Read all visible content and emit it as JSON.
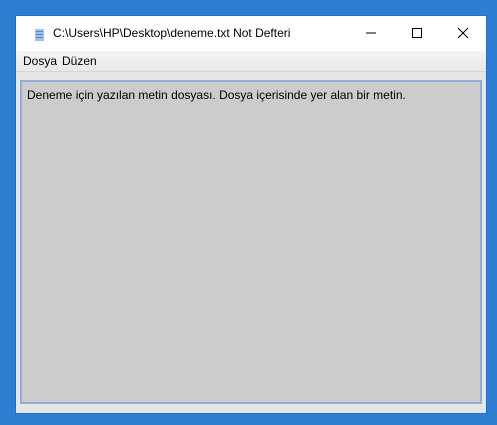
{
  "window": {
    "title": "C:\\Users\\HP\\Desktop\\deneme.txt Not Defteri"
  },
  "menu": {
    "items": [
      "Dosya",
      "Düzen"
    ]
  },
  "editor": {
    "text": "Deneme için yazılan metin dosyası. Dosya içerisinde yer alan bir metin."
  },
  "icons": {
    "app": "notepad-icon",
    "minimize": "minimize-icon",
    "maximize": "maximize-icon",
    "close": "close-icon"
  },
  "colors": {
    "desktop": "#2d7fd2",
    "window_border": "#1f6fd0",
    "editor_background": "#cccccc",
    "editor_border": "#8faed4"
  }
}
